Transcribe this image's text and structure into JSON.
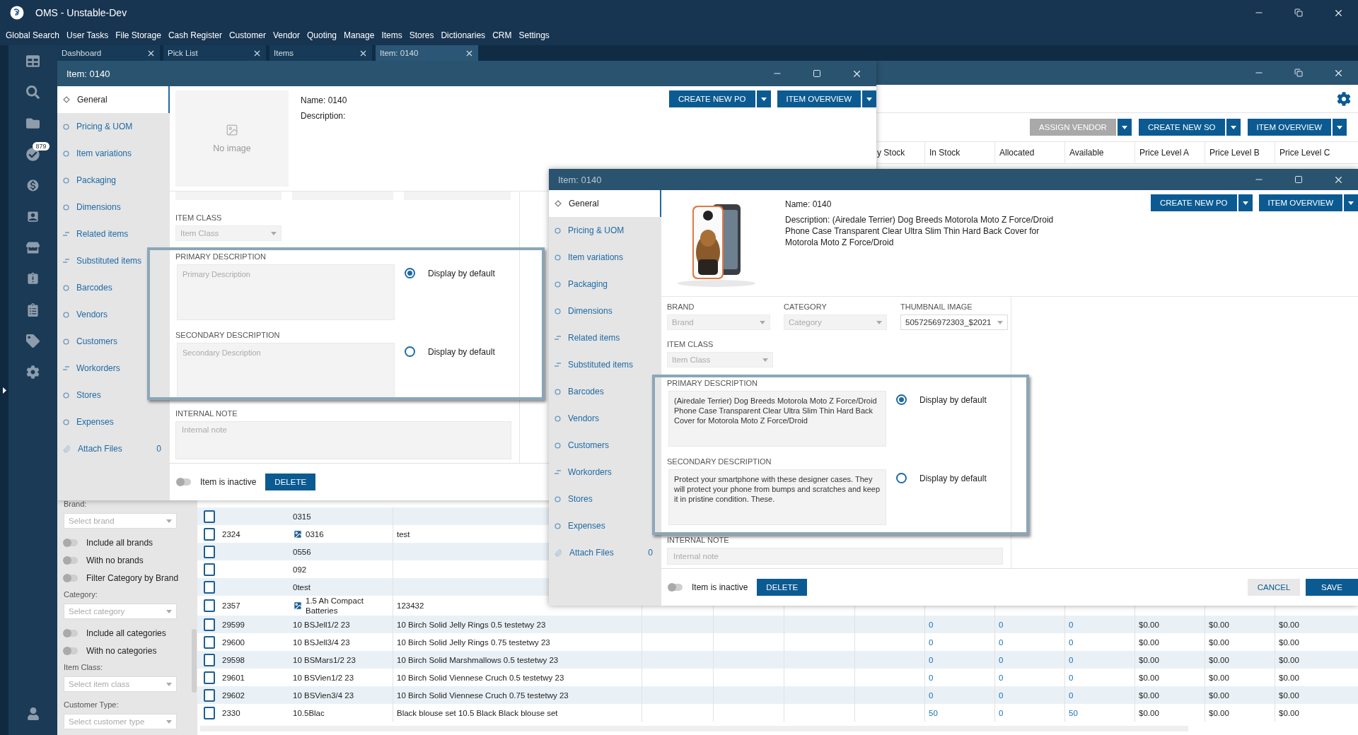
{
  "app": {
    "title": "OMS - Unstable-Dev"
  },
  "menu": [
    "Global Search",
    "User Tasks",
    "File Storage",
    "Cash Register",
    "Customer",
    "Vendor",
    "Quoting",
    "Manage",
    "Items",
    "Stores",
    "Dictionaries",
    "CRM",
    "Settings"
  ],
  "rail": {
    "badge": "879"
  },
  "tabs": [
    {
      "label": "Dashboard",
      "selected": false
    },
    {
      "label": "Pick List",
      "selected": false
    },
    {
      "label": "Items",
      "selected": false
    },
    {
      "label": "Item: 0140",
      "selected": true
    }
  ],
  "items_window": {
    "toolbar_buttons": [
      {
        "label": "ASSIGN VENDOR",
        "disabled": true
      },
      {
        "label": "CREATE NEW SO",
        "disabled": false
      },
      {
        "label": "ITEM OVERVIEW",
        "disabled": false
      }
    ],
    "columns": [
      "y Stock",
      "In Stock",
      "Allocated",
      "Available",
      "Price Level A",
      "Price Level B",
      "Price Level C"
    ],
    "filters": [
      {
        "kind": "label",
        "text": "Brand:"
      },
      {
        "kind": "select",
        "placeholder": "Select brand"
      },
      {
        "kind": "toggle",
        "label": "Include all brands",
        "on": false
      },
      {
        "kind": "toggle",
        "label": "With no brands",
        "on": false
      },
      {
        "kind": "toggle",
        "label": "Filter Category by Brand",
        "on": false
      },
      {
        "kind": "label",
        "text": "Category:"
      },
      {
        "kind": "select",
        "placeholder": "Select category"
      },
      {
        "kind": "toggle",
        "label": "Include all categories",
        "on": false
      },
      {
        "kind": "toggle",
        "label": "With no categories",
        "on": false
      },
      {
        "kind": "label",
        "text": "Item Class:"
      },
      {
        "kind": "select",
        "placeholder": "Select item class"
      },
      {
        "kind": "label",
        "text": "Customer Type:"
      },
      {
        "kind": "select",
        "placeholder": "Select customer type"
      }
    ],
    "rows": [
      {
        "checked": false,
        "code": "0315",
        "image": false
      },
      {
        "checked": false,
        "id": "2324",
        "code": "0316",
        "image": true,
        "description": "test"
      },
      {
        "checked": false,
        "code": "0556",
        "image": false
      },
      {
        "checked": false,
        "code": "092",
        "image": false
      },
      {
        "checked": false,
        "code": "0test",
        "image": false
      },
      {
        "checked": false,
        "id": "2357",
        "code": "1.5 Ah Compact Batteries",
        "image": true,
        "description": "123432"
      },
      {
        "checked": false,
        "id": "29599",
        "code": "10 BSJell1/2 23",
        "image": false,
        "description": "10 Birch Solid Jelly Rings 0.5 testetwy 23",
        "in_stock": "0",
        "allocated": "0",
        "available": "0",
        "price_level_a": "$0.00",
        "price_level_b": "$0.00",
        "price_level_c": "$0.00"
      },
      {
        "checked": false,
        "id": "29600",
        "code": "10 BSJell3/4 23",
        "image": false,
        "description": "10 Birch Solid Jelly Rings 0.75 testetwy 23",
        "in_stock": "0",
        "allocated": "0",
        "available": "0",
        "price_level_a": "$0.00",
        "price_level_b": "$0.00",
        "price_level_c": "$0.00"
      },
      {
        "checked": false,
        "id": "29598",
        "code": "10 BSMars1/2 23",
        "image": false,
        "description": "10 Birch Solid Marshmallows 0.5 testetwy 23",
        "in_stock": "0",
        "allocated": "0",
        "available": "0",
        "price_level_a": "$0.00",
        "price_level_b": "$0.00",
        "price_level_c": "$0.00"
      },
      {
        "checked": false,
        "id": "29601",
        "code": "10 BSVien1/2 23",
        "image": false,
        "description": "10 Birch Solid Viennese Cruch 0.5 testetwy 23",
        "in_stock": "0",
        "allocated": "0",
        "available": "0",
        "price_level_a": "$0.00",
        "price_level_b": "$0.00",
        "price_level_c": "$0.00"
      },
      {
        "checked": false,
        "id": "29602",
        "code": "10 BSVien3/4 23",
        "image": false,
        "description": "10 Birch Solid Viennese Cruch 0.75 testetwy 23",
        "in_stock": "0",
        "allocated": "0",
        "available": "0",
        "price_level_a": "$0.00",
        "price_level_b": "$0.00",
        "price_level_c": "$0.00"
      },
      {
        "checked": false,
        "id": "2330",
        "code": "10.5Blac",
        "image": false,
        "description": "Black blouse set 10.5 Black Black blouse set",
        "in_stock": "50",
        "allocated": "0",
        "available": "50",
        "price_level_a": "$0.00",
        "price_level_b": "$0.00",
        "price_level_c": "$0.00"
      }
    ]
  },
  "dialogs": [
    {
      "title": "Item: 0140",
      "active": true,
      "nav": [
        {
          "label": "General",
          "kind": "diamond",
          "selected": true
        },
        {
          "label": "Pricing & UOM",
          "kind": "circle",
          "selected": false
        },
        {
          "label": "Item variations",
          "kind": "circle",
          "selected": false
        },
        {
          "label": "Packaging",
          "kind": "circle",
          "selected": false
        },
        {
          "label": "Dimensions",
          "kind": "circle",
          "selected": false
        },
        {
          "label": "Related items",
          "kind": "lines",
          "selected": false
        },
        {
          "label": "Substituted items",
          "kind": "lines",
          "selected": false
        },
        {
          "label": "Barcodes",
          "kind": "circle",
          "selected": false
        },
        {
          "label": "Vendors",
          "kind": "circle",
          "selected": false
        },
        {
          "label": "Customers",
          "kind": "circle",
          "selected": false
        },
        {
          "label": "Workorders",
          "kind": "lines",
          "selected": false
        },
        {
          "label": "Stores",
          "kind": "circle",
          "selected": false
        },
        {
          "label": "Expenses",
          "kind": "circle",
          "selected": false
        },
        {
          "label": "Attach Files",
          "kind": "clip",
          "selected": false,
          "count": "0"
        }
      ],
      "image": {
        "kind": "placeholder",
        "text": "No image"
      },
      "name": "Name: 0140",
      "description": "Description:",
      "header_buttons": [
        "CREATE NEW PO",
        "ITEM OVERVIEW"
      ],
      "item_class": {
        "label": "ITEM CLASS",
        "placeholder": "Item Class"
      },
      "descriptions": [
        {
          "label": "PRIMARY DESCRIPTION",
          "placeholder": "Primary Description",
          "display_by_default": true,
          "radio_label": "Display by default"
        },
        {
          "label": "SECONDARY DESCRIPTION",
          "placeholder": "Secondary Description",
          "display_by_default": false,
          "radio_label": "Display by default"
        }
      ],
      "internal_note": {
        "label": "INTERNAL NOTE",
        "placeholder": "Internal note"
      },
      "inactive": {
        "label": "Item is inactive",
        "on": false
      },
      "footer_buttons": [
        {
          "label": "DELETE",
          "kind": "delete"
        }
      ]
    },
    {
      "title": "Item: 0140",
      "active": false,
      "nav": [
        {
          "label": "General",
          "kind": "diamond",
          "selected": true
        },
        {
          "label": "Pricing & UOM",
          "kind": "circle",
          "selected": false
        },
        {
          "label": "Item variations",
          "kind": "circle",
          "selected": false
        },
        {
          "label": "Packaging",
          "kind": "circle",
          "selected": false
        },
        {
          "label": "Dimensions",
          "kind": "circle",
          "selected": false
        },
        {
          "label": "Related items",
          "kind": "lines",
          "selected": false
        },
        {
          "label": "Substituted items",
          "kind": "lines",
          "selected": false
        },
        {
          "label": "Barcodes",
          "kind": "circle",
          "selected": false
        },
        {
          "label": "Vendors",
          "kind": "circle",
          "selected": false
        },
        {
          "label": "Customers",
          "kind": "circle",
          "selected": false
        },
        {
          "label": "Workorders",
          "kind": "lines",
          "selected": false
        },
        {
          "label": "Stores",
          "kind": "circle",
          "selected": false
        },
        {
          "label": "Expenses",
          "kind": "circle",
          "selected": false
        },
        {
          "label": "Attach Files",
          "kind": "clip",
          "selected": false,
          "count": "0"
        }
      ],
      "image": {
        "kind": "picture"
      },
      "name": "Name: 0140",
      "description": "Description: (Airedale Terrier) Dog Breeds Motorola Moto Z Force/Droid Phone Case Transparent Clear Ultra Slim Thin Hard Back Cover for Motorola Moto Z Force/Droid",
      "header_buttons": [
        "CREATE NEW PO",
        "ITEM OVERVIEW"
      ],
      "top_selects": [
        {
          "label": "BRAND",
          "placeholder": "Brand"
        },
        {
          "label": "CATEGORY",
          "placeholder": "Category"
        },
        {
          "label": "THUMBNAIL IMAGE",
          "value": "5057256972303_$2021"
        }
      ],
      "item_class": {
        "label": "ITEM CLASS",
        "placeholder": "Item Class"
      },
      "descriptions": [
        {
          "label": "PRIMARY DESCRIPTION",
          "value": "(Airedale Terrier) Dog Breeds Motorola Moto Z Force/Droid Phone Case Transparent Clear Ultra Slim Thin Hard Back Cover for Motorola Moto Z Force/Droid",
          "display_by_default": true,
          "radio_label": "Display by default"
        },
        {
          "label": "SECONDARY DESCRIPTION",
          "value": "Protect your smartphone with these designer cases. They will protect your phone from bumps and scratches and keep it in pristine condition. These.",
          "display_by_default": false,
          "radio_label": "Display by default"
        }
      ],
      "internal_note": {
        "label": "INTERNAL NOTE",
        "placeholder": "Internal note"
      },
      "inactive": {
        "label": "Item is inactive",
        "on": false
      },
      "footer_buttons": [
        {
          "label": "DELETE",
          "kind": "delete"
        },
        {
          "label": "CANCEL",
          "kind": "cancel"
        },
        {
          "label": "SAVE",
          "kind": "save"
        }
      ]
    }
  ]
}
